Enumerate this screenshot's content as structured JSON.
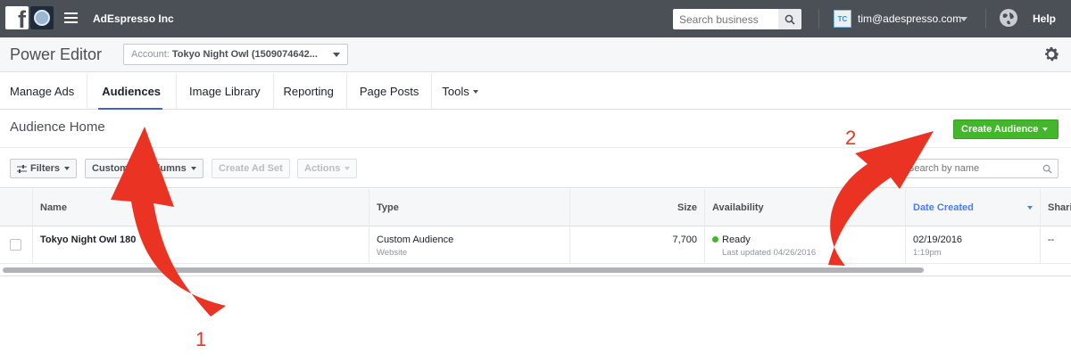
{
  "topbar": {
    "app_name": "AdEspresso Inc",
    "search_placeholder": "Search business",
    "user_initials": "TC",
    "user_email": "tim@adespresso.com",
    "help_label": "Help"
  },
  "subbar": {
    "title": "Power Editor",
    "account_prefix": "Account:",
    "account_value": "Tokyo Night Owl (1509074642..."
  },
  "tabs": [
    {
      "label": "Manage Ads"
    },
    {
      "label": "Audiences"
    },
    {
      "label": "Image Library"
    },
    {
      "label": "Reporting"
    },
    {
      "label": "Page Posts"
    },
    {
      "label": "Tools"
    }
  ],
  "audience_home": {
    "title": "Audience Home",
    "create_label": "Create Audience"
  },
  "toolbar": {
    "filters_label": "Filters",
    "columns_label": "Customize Columns",
    "create_adset_label": "Create Ad Set",
    "actions_label": "Actions",
    "search_placeholder": "Search by name"
  },
  "table": {
    "headers": {
      "name": "Name",
      "type": "Type",
      "size": "Size",
      "availability": "Availability",
      "date_created": "Date Created",
      "sharing": "Shari"
    },
    "rows": [
      {
        "name": "Tokyo Night Owl 180",
        "type": "Custom Audience",
        "subtype": "Website",
        "size": "7,700",
        "status": "Ready",
        "updated": "Last updated 04/26/2016",
        "date": "02/19/2016",
        "time": "1:19pm",
        "sharing": "--"
      }
    ]
  },
  "annotations": {
    "label_1": "1",
    "label_2": "2",
    "color": "#ea3323"
  }
}
